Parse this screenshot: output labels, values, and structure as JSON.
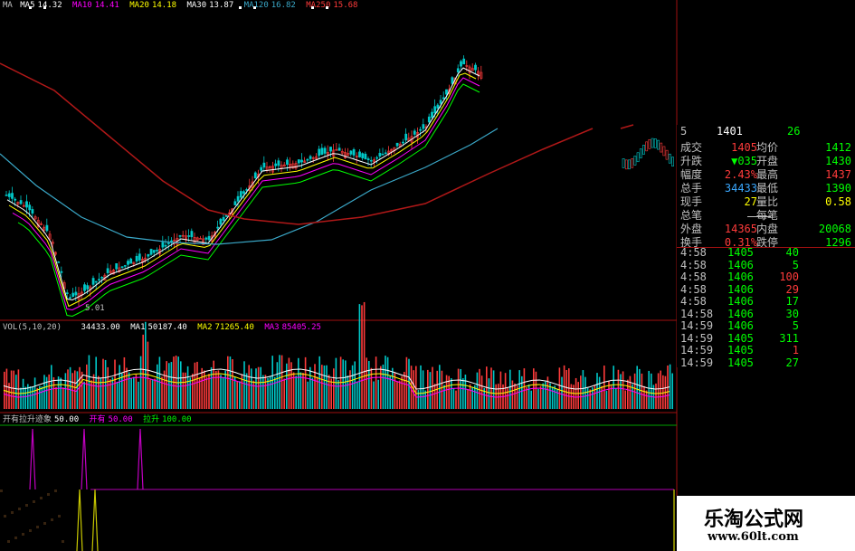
{
  "price_legend": {
    "ma": "MA",
    "ma5": "MA5",
    "ma5_val": "14.32",
    "ma10": "MA10",
    "ma10_val": "14.41",
    "ma20": "MA20",
    "ma20_val": "14.18",
    "ma30": "MA30",
    "ma30_val": "13.87",
    "ma120": "MA120",
    "ma120_val": "16.82",
    "ma250": "MA250",
    "ma250_val": "15.68"
  },
  "low_label": "5.01",
  "vol_legend": {
    "title": "VOL(5,10,20)",
    "vol": "34433.00",
    "ma1": "MA1",
    "ma1_val": "50187.40",
    "ma2": "MA2",
    "ma2_val": "71265.40",
    "ma3": "MA3",
    "ma3_val": "85405.25"
  },
  "ind_legend": {
    "name": "开有拉升迹象",
    "v1": "50.00",
    "kai": "开有",
    "v2": "50.00",
    "la": "拉升",
    "v3": "100.00"
  },
  "quote_top": {
    "a": "5",
    "b": "1401",
    "c": "26"
  },
  "quote": [
    {
      "l1": "成交",
      "v1": "1405",
      "l2": "均价",
      "v2": "1412"
    },
    {
      "l1": "升跌",
      "v1": "▼035",
      "l2": "开盘",
      "v2": "1430"
    },
    {
      "l1": "幅度",
      "v1": "2.43%",
      "l2": "最高",
      "v2": "1437"
    },
    {
      "l1": "总手",
      "v1": "34433",
      "l2": "最低",
      "v2": "1390"
    },
    {
      "l1": "现手",
      "v1": "27",
      "l2": "量比",
      "v2": "0.58"
    },
    {
      "l1": "总笔",
      "v1": "",
      "l2": "每笔",
      "v2": ""
    },
    {
      "l1": "外盘",
      "v1": "14365",
      "l2": "内盘",
      "v2": "20068"
    },
    {
      "l1": "换手",
      "v1": "0.31%",
      "l2": "跌停",
      "v2": "1296"
    }
  ],
  "ticks": [
    {
      "t": "4:58",
      "p": "1405",
      "v": "40"
    },
    {
      "t": "4:58",
      "p": "1406",
      "v": "5"
    },
    {
      "t": "4:58",
      "p": "1406",
      "v": "100"
    },
    {
      "t": "4:58",
      "p": "1406",
      "v": "29"
    },
    {
      "t": "4:58",
      "p": "1406",
      "v": "17"
    },
    {
      "t": "14:58",
      "p": "1406",
      "v": "30"
    },
    {
      "t": "14:59",
      "p": "1406",
      "v": "5"
    },
    {
      "t": "14:59",
      "p": "1405",
      "v": "311"
    },
    {
      "t": "14:59",
      "p": "1405",
      "v": "1"
    },
    {
      "t": "14:59",
      "p": "1405",
      "v": "27"
    }
  ],
  "brand": {
    "name": "乐淘公式网",
    "url": "www.60lt.com"
  },
  "colors": {
    "up": "#ff3b3b",
    "down": "#00c8c8",
    "ma5": "#ffffff",
    "ma10": "#ffff00",
    "ma20": "#ff00ff",
    "ma30": "#00ff00",
    "ma120": "#3aa8c8",
    "ma250": "#b01818"
  }
}
